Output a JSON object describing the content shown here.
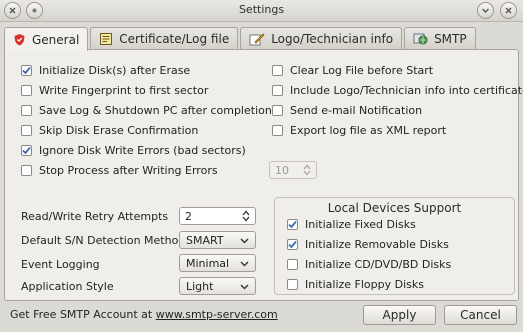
{
  "window": {
    "title": "Settings"
  },
  "tabs": [
    {
      "label": "General",
      "icon": "shield-icon"
    },
    {
      "label": "Certificate/Log file",
      "icon": "certificate-icon"
    },
    {
      "label": "Logo/Technician info",
      "icon": "pen-icon"
    },
    {
      "label": "SMTP",
      "icon": "globe-icon"
    }
  ],
  "checkboxes_left": [
    {
      "label": "Initialize Disk(s) after Erase",
      "checked": true
    },
    {
      "label": "Write Fingerprint to first sector",
      "checked": false
    },
    {
      "label": "Save Log & Shutdown PC after completion",
      "checked": false
    },
    {
      "label": "Skip Disk Erase Confirmation",
      "checked": false
    },
    {
      "label": "Ignore Disk Write Errors (bad sectors)",
      "checked": true
    },
    {
      "label": "Stop Process after Writing Errors",
      "checked": false
    }
  ],
  "checkboxes_right": [
    {
      "label": "Clear Log File before Start",
      "checked": false
    },
    {
      "label": "Include Logo/Technician info into certificate",
      "checked": false
    },
    {
      "label": "Send e-mail Notification",
      "checked": false
    },
    {
      "label": "Export log file as XML report",
      "checked": false
    }
  ],
  "stop_errors_value": "10",
  "fields": {
    "retry_label": "Read/Write Retry Attempts",
    "retry_value": "2",
    "sn_label": "Default S/N Detection Method",
    "sn_value": "SMART",
    "logging_label": "Event Logging",
    "logging_value": "Minimal",
    "style_label": "Application Style",
    "style_value": "Light"
  },
  "local_devices": {
    "title": "Local Devices Support",
    "items": [
      {
        "label": "Initialize Fixed Disks",
        "checked": true
      },
      {
        "label": "Initialize Removable Disks",
        "checked": true
      },
      {
        "label": "Initialize CD/DVD/BD Disks",
        "checked": false
      },
      {
        "label": "Initialize Floppy Disks",
        "checked": false
      }
    ]
  },
  "footer": {
    "text": "Get Free SMTP Account at ",
    "link": "www.smtp-server.com",
    "apply_label": "Apply",
    "cancel_label": "Cancel"
  },
  "colors": {
    "check": "#3b6fb6",
    "accent": "#d9342b"
  }
}
